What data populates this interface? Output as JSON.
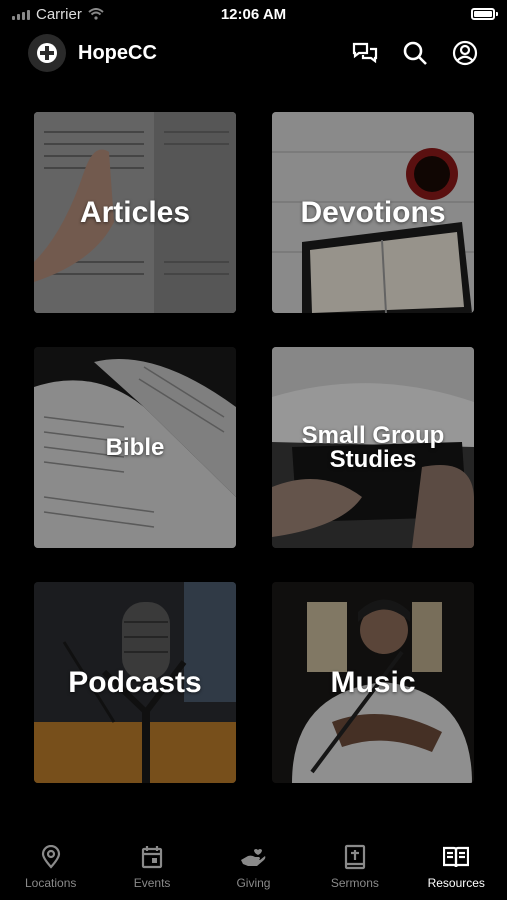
{
  "status_bar": {
    "carrier": "Carrier",
    "time": "12:06 AM"
  },
  "header": {
    "title": "HopeCC"
  },
  "tiles": [
    {
      "label": "Articles",
      "icon": "open-book-hand-photo"
    },
    {
      "label": "Devotions",
      "icon": "bible-and-coffee-photo"
    },
    {
      "label": "Bible",
      "icon": "open-bible-photo"
    },
    {
      "label": "Small Group Studies",
      "icon": "hands-holding-bible-photo"
    },
    {
      "label": "Podcasts",
      "icon": "microphone-photo"
    },
    {
      "label": "Music",
      "icon": "worship-singer-photo"
    }
  ],
  "tabs": [
    {
      "label": "Locations",
      "icon": "location-pin-icon",
      "active": false
    },
    {
      "label": "Events",
      "icon": "calendar-icon",
      "active": false
    },
    {
      "label": "Giving",
      "icon": "giving-hand-icon",
      "active": false
    },
    {
      "label": "Sermons",
      "icon": "bible-cross-icon",
      "active": false
    },
    {
      "label": "Resources",
      "icon": "open-book-icon",
      "active": true
    }
  ],
  "colors": {
    "background": "#000000",
    "active_tab": "#ffffff",
    "inactive_tab": "#8a8a8a"
  }
}
